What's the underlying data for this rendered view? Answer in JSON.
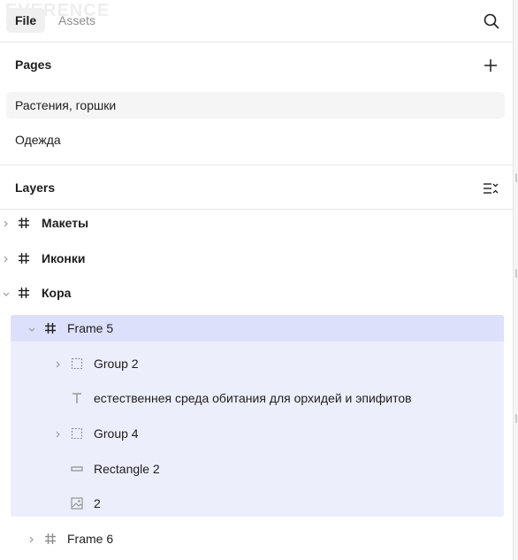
{
  "watermark": "EVERENCE",
  "tabs": {
    "file": "File",
    "assets": "Assets"
  },
  "pages": {
    "title": "Pages",
    "items": [
      {
        "label": "Растения, горшки",
        "current": true
      },
      {
        "label": "Одежда",
        "current": false
      }
    ]
  },
  "layers": {
    "title": "Layers",
    "items": [
      {
        "name": "Макеты",
        "type": "frame",
        "expanded": false,
        "bold": true
      },
      {
        "name": "Иконки",
        "type": "frame",
        "expanded": false,
        "bold": true
      },
      {
        "name": "Кора",
        "type": "frame",
        "expanded": true,
        "bold": true
      },
      {
        "name": "Frame 5",
        "type": "frame",
        "expanded": true,
        "selected": true
      },
      {
        "name": "Group 2",
        "type": "group",
        "expanded": false
      },
      {
        "name": "естественнея среда обитания для орхидей и эпифитов",
        "type": "text"
      },
      {
        "name": "Group 4",
        "type": "group",
        "expanded": false
      },
      {
        "name": "Rectangle 2",
        "type": "rectangle"
      },
      {
        "name": "2",
        "type": "image"
      },
      {
        "name": "Frame 6",
        "type": "frame",
        "expanded": false
      }
    ]
  },
  "icons": {
    "search": "search-icon",
    "add_page": "plus-icon",
    "collapse_layers": "collapse-layers-icon",
    "frame": "hash-icon",
    "group": "dashed-square-icon",
    "text": "text-t-icon",
    "rectangle": "rectangle-icon",
    "image": "image-icon"
  },
  "colors": {
    "selection": "#dde0fa",
    "selection_children": "#eceefc",
    "current_page": "#f5f5f5"
  }
}
